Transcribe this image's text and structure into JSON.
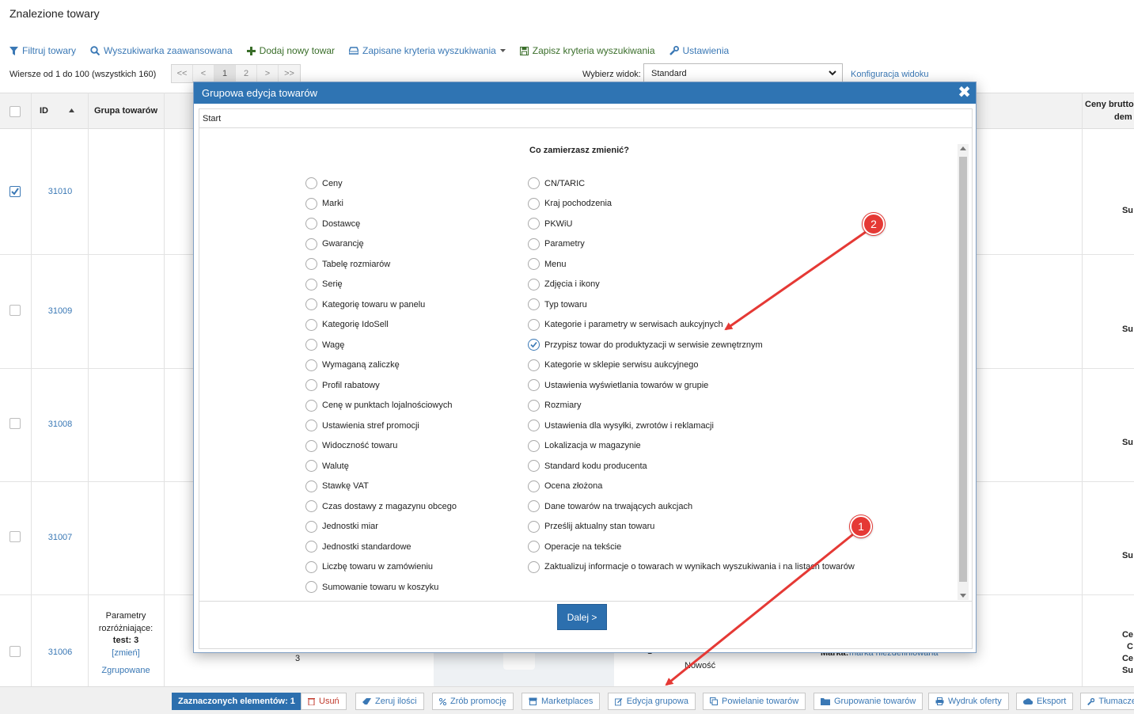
{
  "page_title": "Znalezione towary",
  "toolbar": {
    "filter": "Filtruj towary",
    "advanced_search": "Wyszukiwarka zaawansowana",
    "add_product": "Dodaj nowy towar",
    "saved_criteria": "Zapisane kryteria wyszukiwania",
    "save_criteria": "Zapisz kryteria wyszukiwania",
    "settings": "Ustawienia"
  },
  "pagination": {
    "rows_info": "Wiersze od 1 do 100 (wszystkich 160)",
    "first": "<<",
    "prev": "<",
    "page1": "1",
    "page2": "2",
    "next": ">",
    "last": ">>"
  },
  "view": {
    "label": "Wybierz widok:",
    "selected": "Standard",
    "config_link": "Konfiguracja widoku"
  },
  "grid": {
    "headers": {
      "id": "ID",
      "group": "Grupa towarów",
      "price_line1": "Ceny brutto",
      "price_line2": "dem"
    },
    "rows": [
      {
        "id": "31010",
        "checked": true,
        "right": "Su"
      },
      {
        "id": "31009",
        "checked": false,
        "right": "Su"
      },
      {
        "id": "31008",
        "checked": false,
        "right": "Su"
      },
      {
        "id": "31007",
        "checked": false,
        "right": "Su"
      },
      {
        "id": "31006",
        "checked": false
      }
    ],
    "last_row": {
      "param_line1": "Parametry",
      "param_line2": "rozróżniające:",
      "param_line3": "test: 3",
      "param_change": "[zmień]",
      "grouped": "Zgrupowane",
      "qty": "3",
      "qty2": "1",
      "novelty": "Nowość",
      "brand_label": "Marka:",
      "brand_value": "marka niezdefiniowana",
      "right1": "Ce",
      "right2": "C",
      "right3": "Ce",
      "right4": "Su"
    }
  },
  "modal": {
    "title": "Grupowa edycja towarów",
    "close": "✖",
    "breadcrumb": "Start",
    "question": "Co zamierzasz zmienić?",
    "left_options": [
      "Ceny",
      "Marki",
      "Dostawcę",
      "Gwarancję",
      "Tabelę rozmiarów",
      "Serię",
      "Kategorię towaru w panelu",
      "Kategorię IdoSell",
      "Wagę",
      "Wymaganą zaliczkę",
      "Profil rabatowy",
      "Cenę w punktach lojalnościowych",
      "Ustawienia stref promocji",
      "Widoczność towaru",
      "Walutę",
      "Stawkę VAT",
      "Czas dostawy z magazynu obcego",
      "Jednostki miar",
      "Jednostki standardowe",
      "Liczbę towaru w zamówieniu",
      "Sumowanie towaru w koszyku"
    ],
    "right_options": [
      "CN/TARIC",
      "Kraj pochodzenia",
      "PKWiU",
      "Parametry",
      "Menu",
      "Zdjęcia i ikony",
      "Typ towaru",
      "Kategorie i parametry w serwisach aukcyjnych",
      "Przypisz towar do produktyzacji w serwisie zewnętrznym",
      "Kategorie w sklepie serwisu aukcyjnego",
      "Ustawienia wyświetlania towarów w grupie",
      "Rozmiary",
      "Ustawienia dla wysyłki, zwrotów i reklamacji",
      "Lokalizacja w magazynie",
      "Standard kodu producenta",
      "Ocena złożona",
      "Dane towarów na trwających aukcjach",
      "Prześlij aktualny stan towaru",
      "Operacje na tekście",
      "Zaktualizuj informacje o towarach w wynikach wyszukiwania i na listach towarów"
    ],
    "selected_right_index": 8,
    "next_button": "Dalej >"
  },
  "bottom_bar": {
    "selected_count": "Zaznaczonych elementów: 1",
    "delete": "Usuń",
    "reset_qty": "Zeruj ilości",
    "promo": "Zrób promocję",
    "marketplaces": "Marketplaces",
    "group_edit": "Edycja grupowa",
    "duplicate": "Powielanie towarów",
    "grouping": "Grupowanie towarów",
    "print_offer": "Wydruk oferty",
    "export": "Eksport",
    "translate": "Tłumacze"
  },
  "annotations": {
    "badge1": "1",
    "badge2": "2",
    "color": "#e53935"
  },
  "colors": {
    "accent": "#2f74b3",
    "link": "#3a78b5",
    "green": "#3a6e2a",
    "danger": "#c0392b"
  }
}
